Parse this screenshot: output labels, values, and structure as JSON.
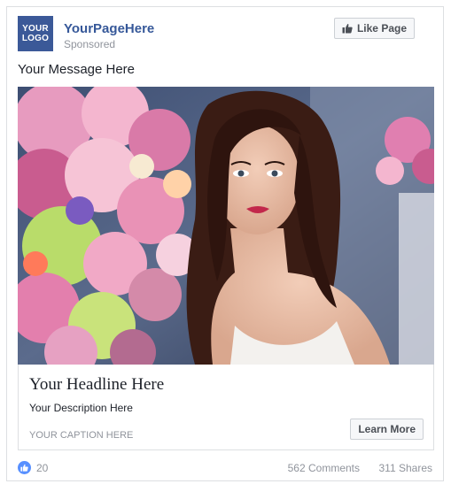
{
  "ad": {
    "logo_line1": "YOUR",
    "logo_line2": "LOGO",
    "page_name": "YourPageHere",
    "sponsored": "Sponsored",
    "like_page_label": "Like Page",
    "message": "Your Message Here",
    "headline": "Your Headline Here",
    "description": "Your Description Here",
    "caption": "YOUR CAPTION HERE",
    "cta_label": "Learn More"
  },
  "engagement": {
    "likes": "20",
    "comments": "562 Comments",
    "shares": "311 Shares"
  },
  "icons": {
    "like_page": "thumbs-up-icon",
    "reaction": "like-reaction-icon"
  },
  "colors": {
    "brand": "#3b5998",
    "page_name": "#365899",
    "reaction": "#5890ff"
  }
}
